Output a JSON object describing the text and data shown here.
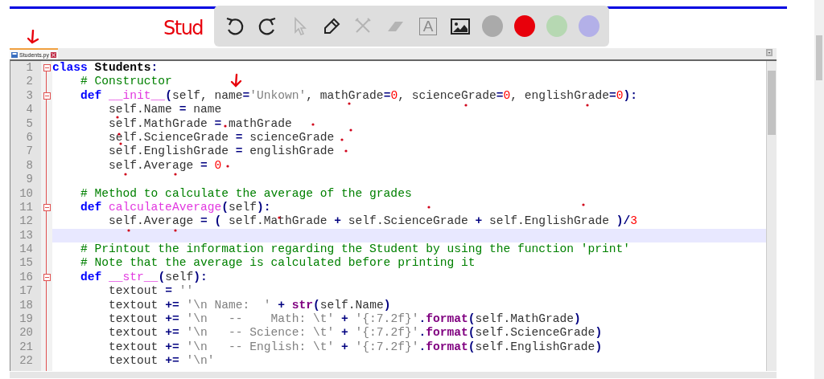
{
  "annotations": {
    "handwriting": "Stud"
  },
  "toolbar": {
    "tools": [
      {
        "kind": "undo",
        "disabled": false
      },
      {
        "kind": "redo",
        "disabled": false
      },
      {
        "kind": "pointer",
        "disabled": true
      },
      {
        "kind": "pen",
        "disabled": false
      },
      {
        "kind": "tools",
        "disabled": true
      },
      {
        "kind": "eraser",
        "disabled": true
      },
      {
        "kind": "text",
        "label": "A",
        "disabled": true
      },
      {
        "kind": "image",
        "disabled": false
      }
    ],
    "colors": [
      {
        "color": "#aaaaaa"
      },
      {
        "color": "#e8000b"
      },
      {
        "color": "#b6d8b2"
      },
      {
        "color": "#b3b0e8"
      }
    ]
  },
  "tabs": [
    {
      "label": "Students.py",
      "selected": true
    }
  ],
  "editor": {
    "lines": [
      {
        "number": "1",
        "fold_start": true,
        "tokens": [
          {
            "kind": "kw",
            "text": "class "
          },
          {
            "kind": "cls",
            "text": "Students"
          },
          {
            "kind": "op",
            "text": ":"
          }
        ]
      },
      {
        "number": "2",
        "fold_start": false,
        "tokens": [
          {
            "kind": "com",
            "text": "    # Constructor"
          }
        ]
      },
      {
        "number": "3",
        "fold_start": true,
        "tokens": [
          {
            "kind": "kw",
            "text": "    def "
          },
          {
            "kind": "fn",
            "text": "__init__"
          },
          {
            "kind": "op",
            "text": "("
          },
          {
            "kind": "plain",
            "text": "self, name"
          },
          {
            "kind": "op",
            "text": "="
          },
          {
            "kind": "str",
            "text": "'Unkown'"
          },
          {
            "kind": "plain",
            "text": ", mathGrade"
          },
          {
            "kind": "op",
            "text": "="
          },
          {
            "kind": "num",
            "text": "0"
          },
          {
            "kind": "plain",
            "text": ", scienceGrade"
          },
          {
            "kind": "op",
            "text": "="
          },
          {
            "kind": "num",
            "text": "0"
          },
          {
            "kind": "plain",
            "text": ", englishGrade"
          },
          {
            "kind": "op",
            "text": "="
          },
          {
            "kind": "num",
            "text": "0"
          },
          {
            "kind": "op",
            "text": "):"
          }
        ]
      },
      {
        "number": "4",
        "fold_start": false,
        "tokens": [
          {
            "kind": "plain",
            "text": "        self.Name "
          },
          {
            "kind": "op",
            "text": "="
          },
          {
            "kind": "plain",
            "text": " name"
          }
        ]
      },
      {
        "number": "5",
        "fold_start": false,
        "tokens": [
          {
            "kind": "plain",
            "text": "        self.MathGrade "
          },
          {
            "kind": "op",
            "text": "="
          },
          {
            "kind": "plain",
            "text": " mathGrade"
          }
        ]
      },
      {
        "number": "6",
        "fold_start": false,
        "tokens": [
          {
            "kind": "plain",
            "text": "        self.ScienceGrade "
          },
          {
            "kind": "op",
            "text": "="
          },
          {
            "kind": "plain",
            "text": " scienceGrade"
          }
        ]
      },
      {
        "number": "7",
        "fold_start": false,
        "tokens": [
          {
            "kind": "plain",
            "text": "        self.EnglishGrade "
          },
          {
            "kind": "op",
            "text": "="
          },
          {
            "kind": "plain",
            "text": " englishGrade"
          }
        ]
      },
      {
        "number": "8",
        "fold_start": false,
        "tokens": [
          {
            "kind": "plain",
            "text": "        self.Average "
          },
          {
            "kind": "op",
            "text": "= "
          },
          {
            "kind": "num",
            "text": "0"
          }
        ]
      },
      {
        "number": "9",
        "fold_start": false
      },
      {
        "number": "10",
        "fold_start": false,
        "tokens": [
          {
            "kind": "com",
            "text": "    # Method to calculate the average of the grades"
          }
        ]
      },
      {
        "number": "11",
        "fold_start": true,
        "tokens": [
          {
            "kind": "kw",
            "text": "    def "
          },
          {
            "kind": "fn",
            "text": "calculateAverage"
          },
          {
            "kind": "op",
            "text": "("
          },
          {
            "kind": "plain",
            "text": "self"
          },
          {
            "kind": "op",
            "text": "):"
          }
        ]
      },
      {
        "number": "12",
        "fold_start": false,
        "tokens": [
          {
            "kind": "plain",
            "text": "        self.Average "
          },
          {
            "kind": "op",
            "text": "= ("
          },
          {
            "kind": "plain",
            "text": " self.MathGrade "
          },
          {
            "kind": "op",
            "text": "+"
          },
          {
            "kind": "plain",
            "text": " self.ScienceGrade "
          },
          {
            "kind": "op",
            "text": "+"
          },
          {
            "kind": "plain",
            "text": " self.EnglishGrade "
          },
          {
            "kind": "op",
            "text": ")/"
          },
          {
            "kind": "num",
            "text": "3"
          }
        ]
      },
      {
        "number": "13",
        "fold_start": false,
        "current": true
      },
      {
        "number": "14",
        "fold_start": false,
        "tokens": [
          {
            "kind": "com",
            "text": "    # Printout the information regarding the Student by using the function 'print'"
          }
        ]
      },
      {
        "number": "15",
        "fold_start": false,
        "tokens": [
          {
            "kind": "com",
            "text": "    # Note that the average is calculated before printing it"
          }
        ]
      },
      {
        "number": "16",
        "fold_start": true,
        "tokens": [
          {
            "kind": "kw",
            "text": "    def "
          },
          {
            "kind": "fn",
            "text": "__str__"
          },
          {
            "kind": "op",
            "text": "("
          },
          {
            "kind": "plain",
            "text": "self"
          },
          {
            "kind": "op",
            "text": "):"
          }
        ]
      },
      {
        "number": "17",
        "fold_start": false,
        "tokens": [
          {
            "kind": "plain",
            "text": "        textout "
          },
          {
            "kind": "op",
            "text": "= "
          },
          {
            "kind": "str",
            "text": "''"
          }
        ]
      },
      {
        "number": "18",
        "fold_start": false,
        "tokens": [
          {
            "kind": "plain",
            "text": "        textout "
          },
          {
            "kind": "op",
            "text": "+= "
          },
          {
            "kind": "str",
            "text": "'\\n Name:  ' "
          },
          {
            "kind": "op",
            "text": "+ "
          },
          {
            "kind": "builtin",
            "text": "str"
          },
          {
            "kind": "op",
            "text": "("
          },
          {
            "kind": "plain",
            "text": "self.Name"
          },
          {
            "kind": "op",
            "text": ")"
          }
        ]
      },
      {
        "number": "19",
        "fold_start": false,
        "tokens": [
          {
            "kind": "plain",
            "text": "        textout "
          },
          {
            "kind": "op",
            "text": "+= "
          },
          {
            "kind": "str",
            "text": "'\\n   --    Math: \\t' "
          },
          {
            "kind": "op",
            "text": "+ "
          },
          {
            "kind": "str",
            "text": "'{:7.2f}'"
          },
          {
            "kind": "op",
            "text": "."
          },
          {
            "kind": "builtin",
            "text": "format"
          },
          {
            "kind": "op",
            "text": "("
          },
          {
            "kind": "plain",
            "text": "self.MathGrade"
          },
          {
            "kind": "op",
            "text": ")"
          }
        ]
      },
      {
        "number": "20",
        "fold_start": false,
        "tokens": [
          {
            "kind": "plain",
            "text": "        textout "
          },
          {
            "kind": "op",
            "text": "+= "
          },
          {
            "kind": "str",
            "text": "'\\n   -- Science: \\t' "
          },
          {
            "kind": "op",
            "text": "+ "
          },
          {
            "kind": "str",
            "text": "'{:7.2f}'"
          },
          {
            "kind": "op",
            "text": "."
          },
          {
            "kind": "builtin",
            "text": "format"
          },
          {
            "kind": "op",
            "text": "("
          },
          {
            "kind": "plain",
            "text": "self.ScienceGrade"
          },
          {
            "kind": "op",
            "text": ")"
          }
        ]
      },
      {
        "number": "21",
        "fold_start": false,
        "tokens": [
          {
            "kind": "plain",
            "text": "        textout "
          },
          {
            "kind": "op",
            "text": "+= "
          },
          {
            "kind": "str",
            "text": "'\\n   -- English: \\t' "
          },
          {
            "kind": "op",
            "text": "+ "
          },
          {
            "kind": "str",
            "text": "'{:7.2f}'"
          },
          {
            "kind": "op",
            "text": "."
          },
          {
            "kind": "builtin",
            "text": "format"
          },
          {
            "kind": "op",
            "text": "("
          },
          {
            "kind": "plain",
            "text": "self.EnglishGrade"
          },
          {
            "kind": "op",
            "text": ")"
          }
        ]
      },
      {
        "number": "22",
        "fold_start": false,
        "tokens": [
          {
            "kind": "plain",
            "text": "        textout "
          },
          {
            "kind": "op",
            "text": "+= "
          },
          {
            "kind": "str",
            "text": "'\\n'"
          }
        ]
      }
    ]
  }
}
